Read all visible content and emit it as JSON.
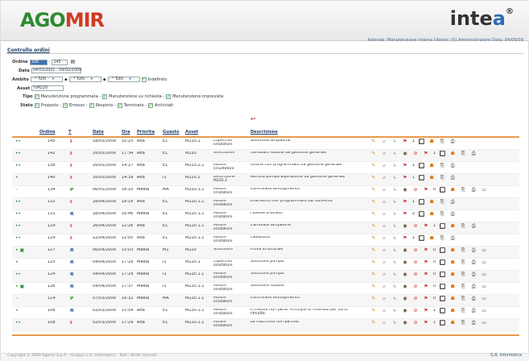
{
  "header": {
    "logo_left_a": "AGO",
    "logo_left_b": "MIR",
    "logo_right_main": "inte",
    "logo_right_accent": "a",
    "logo_right_suffix": "®",
    "user_line": "Azienda: Manutenzione interna  Utente: (0) Amministratore  Data: 04/06/09"
  },
  "page": {
    "title": "Controllo ordini"
  },
  "filters": {
    "ordine_label": "Ordine",
    "ordine_from": "100",
    "ordine_to": "145",
    "data_label": "Data",
    "data_value": "04/01/2001 - 09/02/2009",
    "ambito_label": "Ambito",
    "ambito1": "- * Tutti -",
    "ambito2": "- * Tutti -",
    "ambito3": "- * Tutti -",
    "indefinito": "Indefinito",
    "asset_label": "Asset",
    "asset_value": "%M220",
    "tipo_label": "Tipo",
    "tipo1": "Manutenzione programmata -",
    "tipo2": "Manutenzione su richiesta -",
    "tipo3": "Manutenzione imprevista",
    "stato_label": "Stato",
    "stato1": "Proposto -",
    "stato2": "Emesso -",
    "stato3": "Respinto -",
    "stato4": "Terminato -",
    "stato5": "Archiviati"
  },
  "table": {
    "headers": [
      "Ordine",
      "T",
      "Data",
      "Ora",
      "Priorita",
      "Guasto",
      "Asset",
      "Descrizione"
    ],
    "rows": [
      {
        "dots": "••",
        "ord": "145",
        "t": "I",
        "data": "18/05/2009",
        "ora": "10:25",
        "pri": "Alta",
        "gu": "E1",
        "asset": "M220.1",
        "name": "Coperchio smatatore",
        "desc": "Sostituita lampadina",
        "cnt": "1"
      },
      {
        "dots": "••",
        "ord": "142",
        "t": "I",
        "data": "16/05/2009",
        "ora": "17:34",
        "pri": "Alta",
        "gu": "E1",
        "asset": "M220",
        "name": "Sinistratore",
        "desc": "Cambiato fusibile da gestione generale",
        "cnt": "1"
      },
      {
        "dots": "••",
        "ord": "138",
        "t": "I",
        "data": "16/05/2009",
        "ora": "14:27",
        "pri": "Alta",
        "gu": "E1",
        "asset": "M220.2.1",
        "name": "Motore sinustatore",
        "desc": "Ordine non programmato da gestione generale.",
        "cnt": "1"
      },
      {
        "dots": "•",
        "ord": "140",
        "t": "I",
        "data": "16/05/2009",
        "ora": "14:39",
        "pri": "Alta",
        "gu": "I1",
        "asset": "M220.2",
        "name": "Descrizione M220.2",
        "desc": "Rottura pompa aspirazione da gestione generale",
        "cnt": "1"
      },
      {
        "dots": "◦",
        "ord": "134",
        "t": "P",
        "data": "06/05/2009",
        "ora": "18:10",
        "pri": "Media",
        "gu": "MA",
        "asset": "M220.1.1",
        "name": "Motore smatatore",
        "desc": "Controllare avvolgimento.",
        "cnt": "0"
      },
      {
        "dots": "••",
        "ord": "132",
        "t": "I",
        "data": "28/04/2009",
        "ora": "18:16",
        "pri": "Alta",
        "gu": "E1",
        "asset": "M220.1.1",
        "name": "Motore smatatore",
        "desc": "Intervento non programmato del 28/04/09",
        "cnt": "1"
      },
      {
        "dots": "••",
        "ord": "131",
        "t": "R",
        "data": "28/04/2009",
        "ora": "16:46",
        "pri": "Media",
        "gu": "E1",
        "asset": "M220.1.1",
        "name": "Motore smatatore",
        "desc": "Fusibile bruciato.",
        "cnt": "2"
      },
      {
        "dots": "••",
        "ord": "129",
        "t": "I",
        "data": "26/04/2009",
        "ora": "12:26",
        "pri": "Alta",
        "gu": "E1",
        "asset": "M220.1.1",
        "name": "Motore smatatore",
        "desc": "Cambiata lampadina",
        "cnt": "1"
      },
      {
        "dots": "••",
        "ord": "129",
        "t": "I",
        "data": "12/04/2009",
        "ora": "12:05",
        "pri": "Alta",
        "gu": "E1",
        "asset": "M220.1.1",
        "name": "Motore smatatore",
        "desc": "Cavallotto",
        "cnt": "1"
      },
      {
        "dots": "• ▣",
        "ord": "127",
        "t": "R",
        "data": "06/04/2009",
        "ora": "15:03",
        "pri": "Media",
        "gu": "M1",
        "asset": "M220",
        "name": "Smatatore",
        "desc": "Prova strutturale",
        "cnt": "0"
      },
      {
        "dots": "•",
        "ord": "125",
        "t": "R",
        "data": "04/04/2009",
        "ora": "17:29",
        "pri": "Media",
        "gu": "I1",
        "asset": "M220.1",
        "name": "Coperchio smatatore",
        "desc": "Sostituire pompa.",
        "cnt": "0"
      },
      {
        "dots": "••",
        "ord": "124",
        "t": "R",
        "data": "04/04/2009",
        "ora": "17:29",
        "pri": "Media",
        "gu": "I1",
        "asset": "M220.1.1",
        "name": "Motore smatatore",
        "desc": "Sostituire pompa.",
        "cnt": "0"
      },
      {
        "dots": "• ▣",
        "ord": "126",
        "t": "R",
        "data": "04/04/2009",
        "ora": "17:37",
        "pri": "Media",
        "gu": "I1",
        "asset": "M220.1.1",
        "name": "Motore smatatore",
        "desc": "Sostituire fusibile.",
        "cnt": "0"
      },
      {
        "dots": "◦",
        "ord": "114",
        "t": "P",
        "data": "07/03/2009",
        "ora": "16:32",
        "pri": "Media",
        "gu": "MA",
        "asset": "M220.1.1",
        "name": "Motore smatatore",
        "desc": "Controllare avvolgimento.",
        "cnt": "0"
      },
      {
        "dots": "•",
        "ord": "106",
        "t": "R",
        "data": "02/03/2009",
        "ora": "15:54",
        "pri": "Alta",
        "gu": "E1",
        "asset": "M220.1.1",
        "name": "Motore smatatore",
        "desc": "Il motore non parte. Principio di incendio per corto circuito.",
        "cnt": "1"
      },
      {
        "dots": "••",
        "ord": "108",
        "t": "I",
        "data": "02/03/2009",
        "ora": "17:29",
        "pri": "Alta",
        "gu": "E1",
        "asset": "M220.1.1",
        "name": "Motore smatatore",
        "desc": "La macchina non partiva.",
        "cnt": "1"
      }
    ]
  },
  "footer": {
    "copyright": "Copyright © 2009 Agomir S.p.A. - Gruppo G.R. Informatica - Tutti i diritti riservati",
    "brand": "G.R. Informatica"
  },
  "colors": {
    "accent_orange": "#e99a4c",
    "title_blue": "#1f3f66",
    "logo_green": "#2f8a2f",
    "logo_red": "#d13b22"
  }
}
